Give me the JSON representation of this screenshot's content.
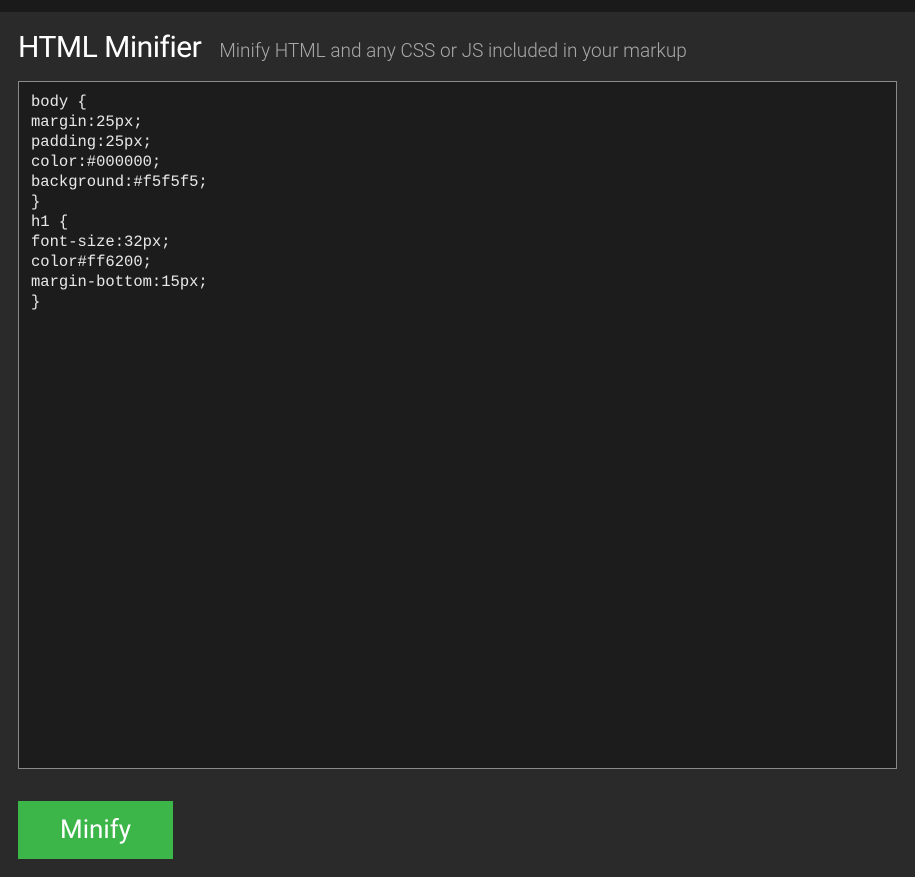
{
  "header": {
    "title": "HTML Minifier",
    "subtitle": "Minify HTML and any CSS or JS included in your markup"
  },
  "editor": {
    "value": "body {\nmargin:25px;\npadding:25px;\ncolor:#000000;\nbackground:#f5f5f5;\n}\nh1 {\nfont-size:32px;\ncolor#ff6200;\nmargin-bottom:15px;\n}"
  },
  "actions": {
    "minify_label": "Minify"
  }
}
